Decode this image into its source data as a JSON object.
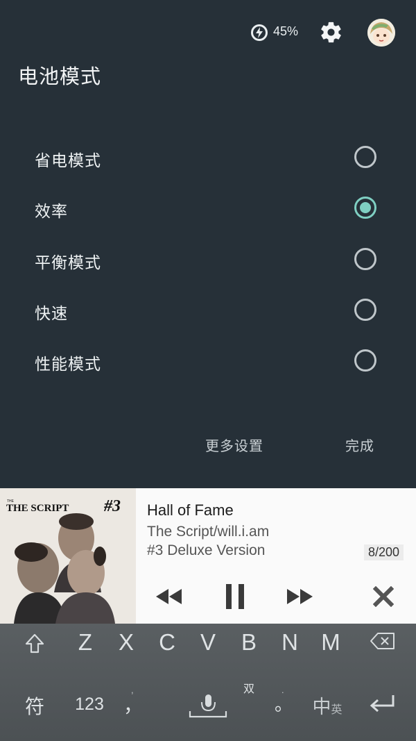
{
  "status_bar": {
    "battery_percent": "45%"
  },
  "panel": {
    "title": "电池模式",
    "options": [
      {
        "label": "省电模式",
        "selected": false
      },
      {
        "label": "效率",
        "selected": true
      },
      {
        "label": "平衡模式",
        "selected": false
      },
      {
        "label": "快速",
        "selected": false
      },
      {
        "label": "性能模式",
        "selected": false
      }
    ],
    "more_settings": "更多设置",
    "done": "完成"
  },
  "music": {
    "album_art": {
      "brand": "THE SCRIPT",
      "number": "#3"
    },
    "song": "Hall of Fame",
    "artist": "The Script/will.i.am",
    "album": "#3 Deluxe Version",
    "track": "8/200"
  },
  "keyboard": {
    "letters": [
      "Z",
      "X",
      "C",
      "V",
      "B",
      "N",
      "M"
    ],
    "symbols_key": "符",
    "numbers_key": "123",
    "comma_key": "，",
    "space_hint": "双",
    "period_key": "。",
    "lang_key_main": "中",
    "lang_key_sub": "英"
  },
  "colors": {
    "panel_bg": "#263038",
    "accent": "#7fcfc2"
  }
}
